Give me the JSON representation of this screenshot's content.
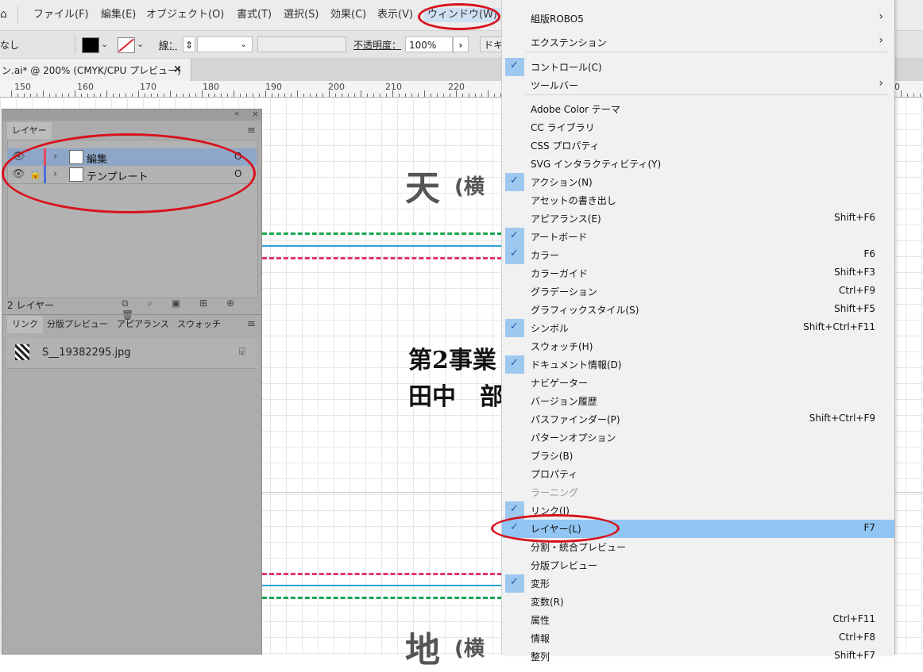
{
  "menubar": {
    "items": [
      "ファイル(F)",
      "編集(E)",
      "オブジェクト(O)",
      "書式(T)",
      "選択(S)",
      "効果(C)",
      "表示(V)",
      "ウィンドウ(W)"
    ]
  },
  "control": {
    "left_label": "なし",
    "stroke_label": "線：",
    "opacity_label": "不透明度：",
    "opacity_value": "100%",
    "doc_label": "ドキ"
  },
  "document_tab": {
    "title": "ン.ai* @ 200% (CMYK/CPU プレビュー)",
    "close": "×"
  },
  "ruler": {
    "labels": [
      "150",
      "160",
      "170",
      "180",
      "190",
      "200",
      "210",
      "220",
      "0"
    ]
  },
  "canvas": {
    "top_heading": "天",
    "top_heading_sub": "(横",
    "middle_line1": "第2事業",
    "middle_line2": "田中　部",
    "bottom_heading": "地",
    "bottom_heading_sub": "(横"
  },
  "layers_panel": {
    "tab": "レイヤー",
    "layers": [
      {
        "name": "編集",
        "selected": true,
        "locked": false,
        "color": "#e5475a"
      },
      {
        "name": "テンプレート",
        "selected": false,
        "locked": true,
        "color": "#4a6fe0"
      }
    ],
    "circle_mark": "O",
    "count": "2 レイヤー"
  },
  "links_panel": {
    "tabs": [
      "リンク",
      "分版プレビュー",
      "アピアランス",
      "スウォッチ"
    ],
    "items": [
      {
        "name": "S__19382295.jpg"
      }
    ]
  },
  "window_menu": {
    "items": [
      {
        "label": "組版ROBO5",
        "submenu": true
      },
      {
        "label": "エクステンション",
        "submenu": true
      },
      {
        "label": "コントロール(C)",
        "checked": true
      },
      {
        "label": "ツールバー",
        "submenu": true
      },
      {
        "label": "Adobe Color テーマ"
      },
      {
        "label": "CC ライブラリ"
      },
      {
        "label": "CSS プロパティ"
      },
      {
        "label": "SVG インタラクティビティ(Y)"
      },
      {
        "label": "アクション(N)",
        "checked": true
      },
      {
        "label": "アセットの書き出し"
      },
      {
        "label": "アピアランス(E)",
        "shortcut": "Shift+F6"
      },
      {
        "label": "アートボード",
        "checked": true
      },
      {
        "label": "カラー",
        "checked": true,
        "shortcut": "F6"
      },
      {
        "label": "カラーガイド",
        "shortcut": "Shift+F3"
      },
      {
        "label": "グラデーション",
        "shortcut": "Ctrl+F9"
      },
      {
        "label": "グラフィックスタイル(S)",
        "shortcut": "Shift+F5"
      },
      {
        "label": "シンボル",
        "checked": true,
        "shortcut": "Shift+Ctrl+F11"
      },
      {
        "label": "スウォッチ(H)"
      },
      {
        "label": "ドキュメント情報(D)",
        "checked": true
      },
      {
        "label": "ナビゲーター"
      },
      {
        "label": "バージョン履歴"
      },
      {
        "label": "パスファインダー(P)",
        "shortcut": "Shift+Ctrl+F9"
      },
      {
        "label": "パターンオプション"
      },
      {
        "label": "ブラシ(B)"
      },
      {
        "label": "プロパティ"
      },
      {
        "label": "ラーニング",
        "disabled": true
      },
      {
        "label": "リンク(I)",
        "checked": true
      },
      {
        "label": "レイヤー(L)",
        "checked": true,
        "shortcut": "F7",
        "highlighted": true
      },
      {
        "label": "分割・統合プレビュー"
      },
      {
        "label": "分版プレビュー"
      },
      {
        "label": "変形",
        "checked": true
      },
      {
        "label": "変数(R)"
      },
      {
        "label": "属性",
        "shortcut": "Ctrl+F11"
      },
      {
        "label": "情報",
        "shortcut": "Ctrl+F8"
      },
      {
        "label": "整列",
        "shortcut": "Shift+F7"
      }
    ]
  },
  "colors": {
    "highlight": "#91c5f3",
    "annotation": "#d8121c",
    "guide_green": "#1aa651",
    "guide_pink": "#e2337a",
    "guide_blue": "#2a9fd8"
  }
}
